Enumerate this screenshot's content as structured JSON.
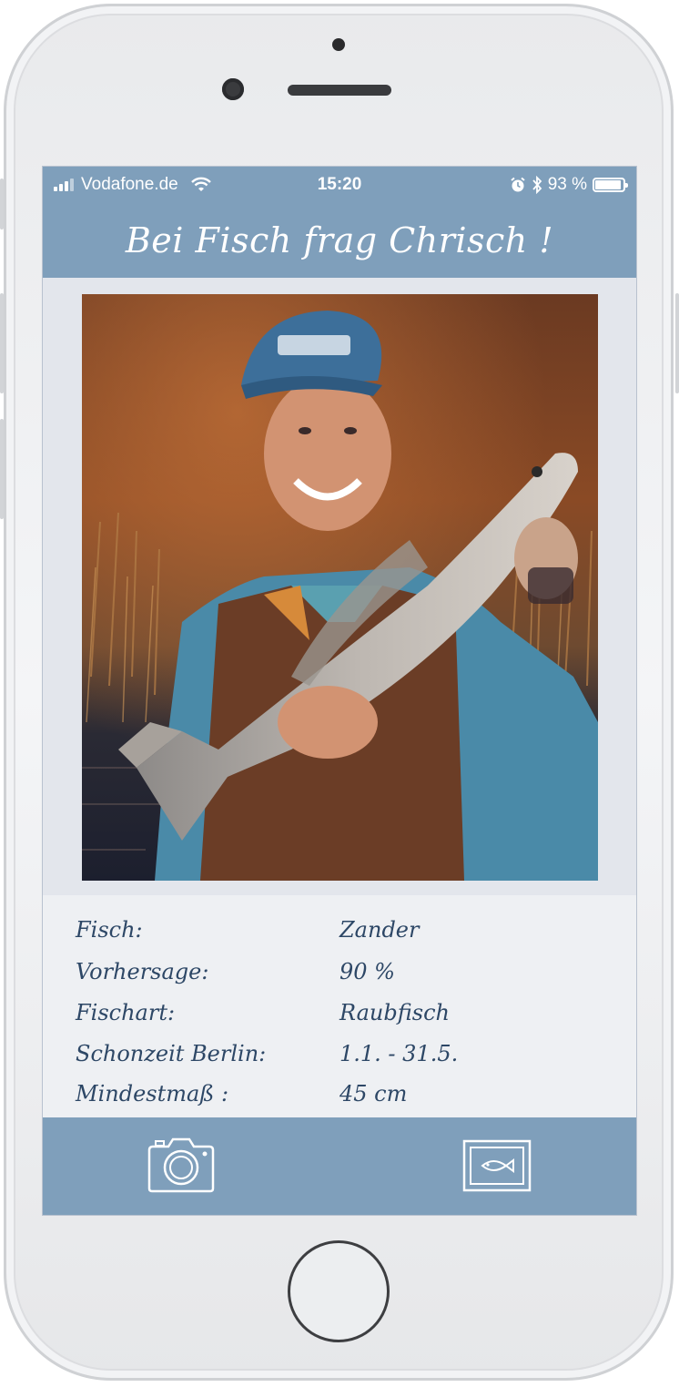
{
  "status_bar": {
    "carrier": "Vodafone.de",
    "time": "15:20",
    "battery": "93 %",
    "battery_level": 0.93,
    "icons": [
      "signal-icon",
      "wifi-icon",
      "alarm-icon",
      "bluetooth-icon",
      "battery-icon"
    ]
  },
  "header": {
    "title": "Bei Fisch frag Chrisch !"
  },
  "photo": {
    "description_icon": "photo-of-angler-with-zander"
  },
  "info": [
    {
      "label": "Fisch:",
      "value": "Zander"
    },
    {
      "label": "Vorhersage:",
      "value": "90 %"
    },
    {
      "label": "Fischart:",
      "value": "Raubfisch"
    },
    {
      "label": "Schonzeit Berlin:",
      "value": "1.1. - 31.5."
    },
    {
      "label": "Mindestmaß :",
      "value": "45 cm"
    }
  ],
  "tab_bar": {
    "camera_icon": "camera-icon",
    "gallery_icon": "fish-picture-icon"
  },
  "colors": {
    "accent": "#7f9fbb",
    "text": "#2d4766",
    "panel": "#eef0f3"
  }
}
